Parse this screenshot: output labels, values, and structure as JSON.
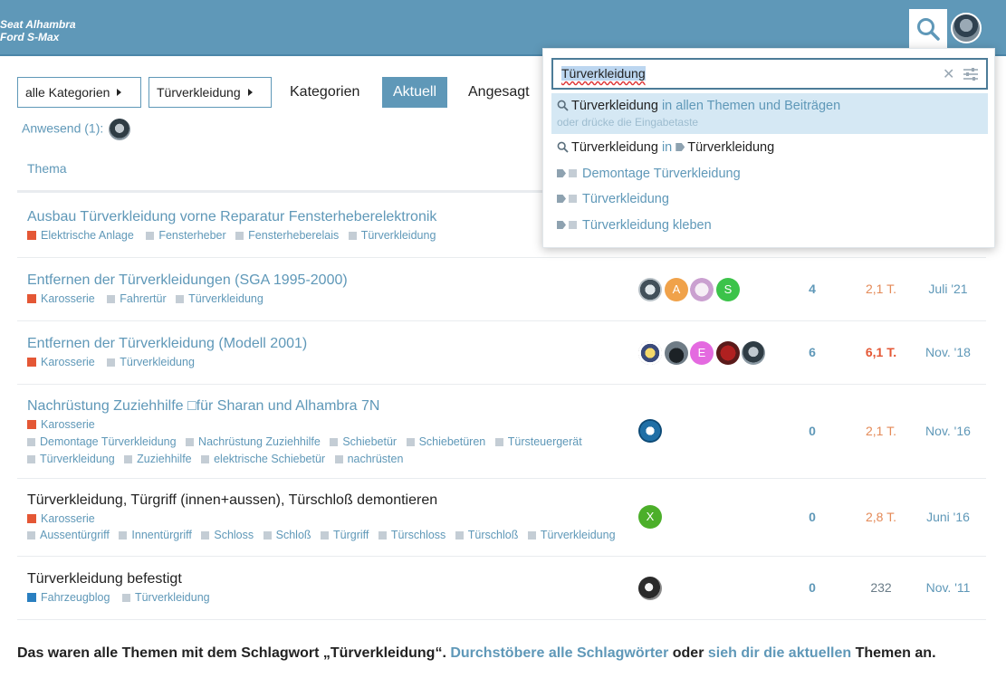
{
  "header": {
    "logo_line1": "Seat Alhambra",
    "logo_line2": "Ford S-Max",
    "search_icon": "search-icon",
    "avatar_icon": "user-avatar"
  },
  "nav": {
    "category_dropdown": "alle Kategorien",
    "tag_dropdown": "Türverkleidung",
    "links": [
      "Kategorien",
      "Aktuell",
      "Angesagt"
    ],
    "active": "Aktuell"
  },
  "present": {
    "label": "Anwesend (1):"
  },
  "table": {
    "header_topic": "Thema",
    "rows": [
      {
        "title": "Ausbau Türverkleidung vorne Reparatur Fensterheberelektronik",
        "category": "Elektrische Anlage",
        "tags": [
          "Fensterheber",
          "Fensterheberelais",
          "Türverkleidung"
        ]
      },
      {
        "title": "Entfernen der Türverkleidungen (SGA 1995-2000)",
        "category": "Karosserie",
        "tags": [
          "Fahrertür",
          "Türverkleidung"
        ],
        "posters": [
          "avatar-photo",
          "A",
          "avatar-drawing",
          "S"
        ],
        "replies": "4",
        "views": "2,1 T.",
        "activity": "Juli '21"
      },
      {
        "title": "Entfernen der Türverkleidung (Modell 2001)",
        "category": "Karosserie",
        "tags": [
          "Türverkleidung"
        ],
        "posters": [
          "avatar-cartoon",
          "avatar-car",
          "E",
          "avatar-red",
          "avatar-car2"
        ],
        "replies": "6",
        "views": "6,1 T.",
        "activity": "Nov. '18"
      },
      {
        "title": "Nachrüstung Zuziehhilfe □für Sharan und Alhambra 7N",
        "category": "Karosserie",
        "tags_line1": [
          "Demontage Türverkleidung",
          "Nachrüstung Zuziehhilfe",
          "Schiebetür",
          "Schiebetüren",
          "Türsteuergerät"
        ],
        "tags_line2": [
          "Türverkleidung",
          "Zuziehhilfe",
          "elektrische Schiebetür",
          "nachrüsten"
        ],
        "posters": [
          "avatar-logo"
        ],
        "replies": "0",
        "views": "2,1 T.",
        "activity": "Nov. '16"
      },
      {
        "title": "Türverkleidung, Türgriff (innen+aussen), Türschloß demontieren",
        "category": "Karosserie",
        "tags": [
          "Aussentürgriff",
          "Innentürgriff",
          "Schloss",
          "Schloß",
          "Türgriff",
          "Türschloss",
          "Türschloß",
          "Türverkleidung"
        ],
        "posters": [
          "X"
        ],
        "replies": "0",
        "views": "2,8 T.",
        "activity": "Juni '16"
      },
      {
        "title": "Türverkleidung befestigt",
        "category": "Fahrzeugblog",
        "tags": [
          "Türverkleidung"
        ],
        "posters": [
          "avatar-bw"
        ],
        "replies": "0",
        "views": "232",
        "activity": "Nov. '11"
      }
    ]
  },
  "footer": {
    "text1": "Das waren alle Themen mit dem Schlagwort „Türverkleidung“. ",
    "link1": "Durchstöbere alle Schlagwörter",
    "text2": " oder ",
    "link2": "sieh dir die aktuellen",
    "text3": " Themen an."
  },
  "search": {
    "value": "Türverkleidung",
    "result1_term": "Türverkleidung",
    "result1_suffix": " in allen Themen und Beiträgen",
    "result1_hint": "oder drücke die Eingabetaste",
    "result2_term": "Türverkleidung",
    "result2_in": " in ",
    "result2_tag": "Türverkleidung",
    "tag_results": [
      "Demontage Türverkleidung",
      "Türverkleidung",
      "Türverkleidung kleben"
    ]
  },
  "colors": {
    "header": "#5f98b8",
    "accent": "#5f98b8",
    "category_red": "#e45735",
    "category_blue": "#2a7fc0"
  }
}
